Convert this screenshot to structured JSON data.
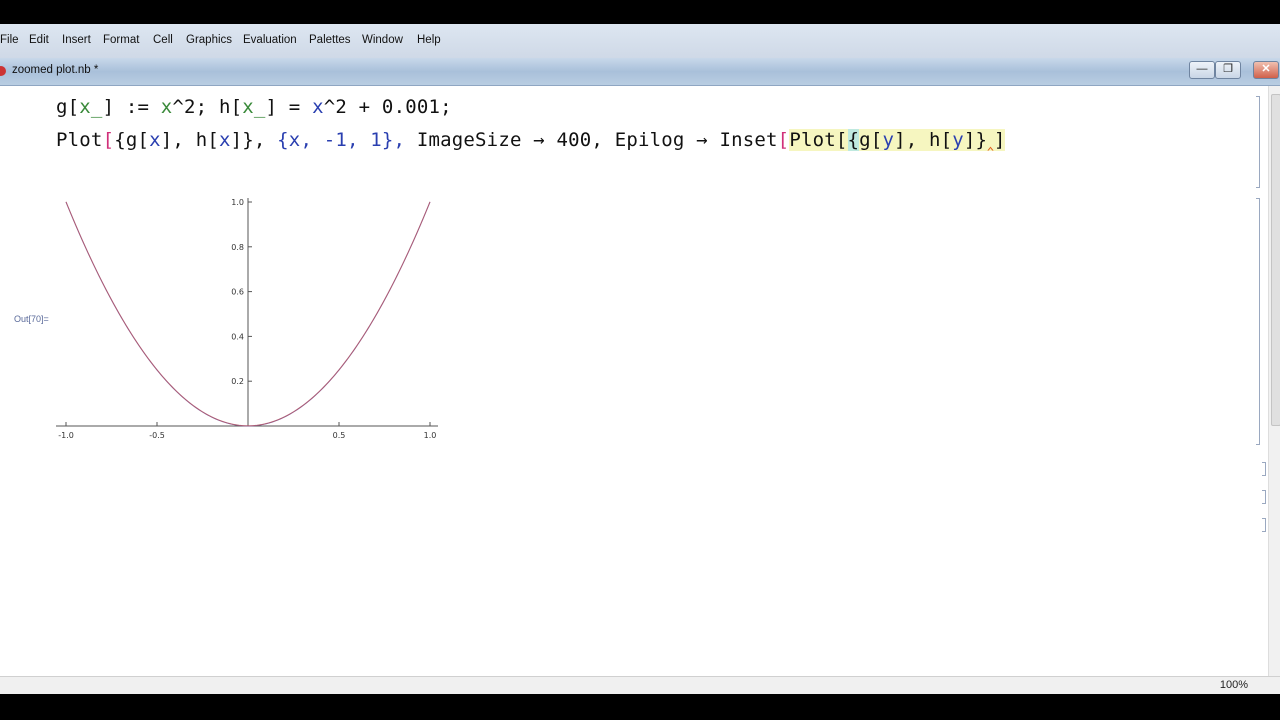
{
  "menu": [
    "File",
    "Edit",
    "Insert",
    "Format",
    "Cell",
    "Graphics",
    "Evaluation",
    "Palettes",
    "Window",
    "Help"
  ],
  "window": {
    "title": "zoomed plot.nb *"
  },
  "input": {
    "line1": {
      "g": "g",
      "x1": "x_",
      "op1": " := ",
      "xsq": "x",
      "pow1": "^2; ",
      "h": "h",
      "x2": "x_",
      "op2": " = ",
      "xsq2": "x",
      "tail": "^2 + 0.001;"
    },
    "line2": {
      "plot": "Plot",
      "open1": "[",
      "brace1": "{",
      "g": "g",
      "gx": "x",
      "sep1": "], ",
      "h": "h",
      "hx": "x",
      "close1": "]}, ",
      "range": "{x, -1, 1}, ",
      "imgsize": "ImageSize → 400, ",
      "epilog": "Epilog → Inset",
      "open2": "[",
      "plot2": "Plot",
      "open3": "[",
      "brace2": "{",
      "gy": "g",
      "y1": "y",
      "mid": "], ",
      "hy": "h",
      "y2": "y",
      "end": "]}",
      "caret": "‸",
      "close2": "]"
    }
  },
  "output": {
    "label": "Out[70]="
  },
  "status": {
    "zoom": "100%"
  },
  "chart_data": {
    "type": "line",
    "series": [
      {
        "name": "",
        "fn": "x^2",
        "color": "#5a4aa0"
      },
      {
        "name": "",
        "fn": "x^2+0.001",
        "color": "#b85a6a"
      }
    ],
    "xlim": [
      -1,
      1
    ],
    "ylim": [
      0,
      1
    ],
    "x_ticks": [
      "-1.0",
      "-0.5",
      "0.5",
      "1.0"
    ],
    "x_tick_values": [
      -1,
      -0.5,
      0.5,
      1
    ],
    "y_ticks": [
      "0.2",
      "0.4",
      "0.6",
      "0.8",
      "1.0"
    ],
    "y_tick_values": [
      0.2,
      0.4,
      0.6,
      0.8,
      1.0
    ],
    "grid": false
  }
}
